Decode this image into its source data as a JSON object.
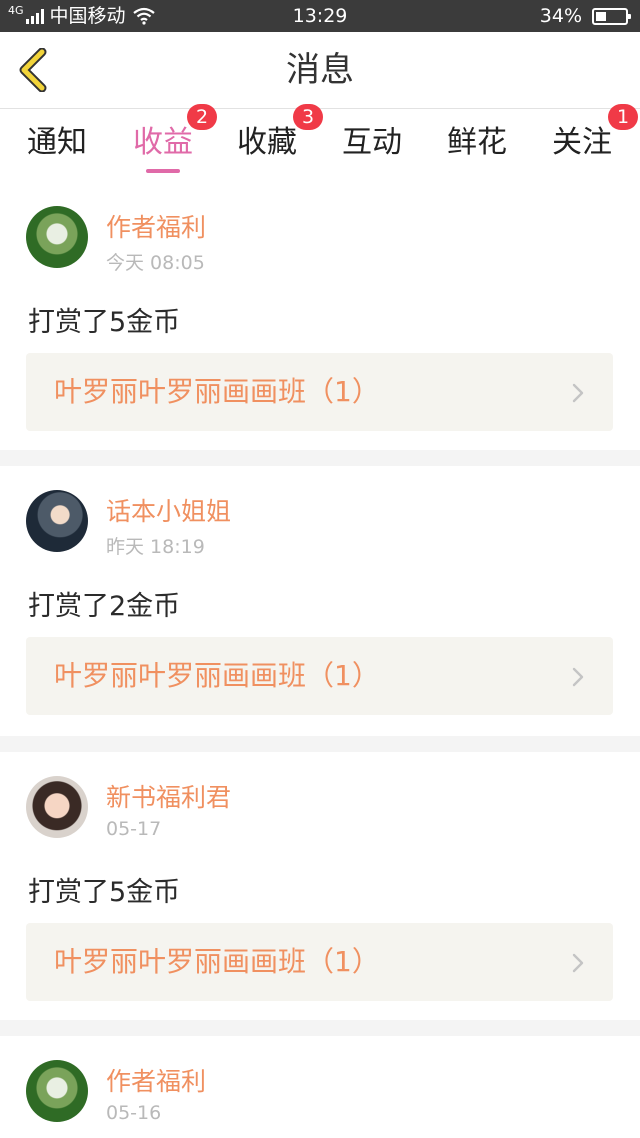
{
  "status_bar": {
    "network": "4G",
    "carrier": "中国移动",
    "time": "13:29",
    "battery": "34%",
    "battery_level": 0.34
  },
  "header": {
    "title": "消息",
    "back_icon": "back-chevron-icon"
  },
  "tabs": [
    {
      "label": "通知",
      "badge": "",
      "active": false
    },
    {
      "label": "收益",
      "badge": "2",
      "active": true
    },
    {
      "label": "收藏",
      "badge": "3",
      "active": false
    },
    {
      "label": "互动",
      "badge": "",
      "active": false
    },
    {
      "label": "鲜花",
      "badge": "",
      "active": false
    },
    {
      "label": "关注",
      "badge": "1",
      "active": false
    }
  ],
  "messages": [
    {
      "author": "作者福利",
      "time": "今天 08:05",
      "text": "打赏了5金币",
      "ref": "叶罗丽叶罗丽画画班（1）"
    },
    {
      "author": "话本小姐姐",
      "time": "昨天 18:19",
      "text": "打赏了2金币",
      "ref": "叶罗丽叶罗丽画画班（1）"
    },
    {
      "author": "新书福利君",
      "time": "05-17",
      "text": "打赏了5金币",
      "ref": "叶罗丽叶罗丽画画班（1）"
    },
    {
      "author": "作者福利",
      "time": "05-16",
      "text": "",
      "ref": ""
    }
  ],
  "colors": {
    "accent": "#e06aa8",
    "author": "#f09060",
    "badge": "#f03a47",
    "back_icon": "#f2d43a"
  }
}
